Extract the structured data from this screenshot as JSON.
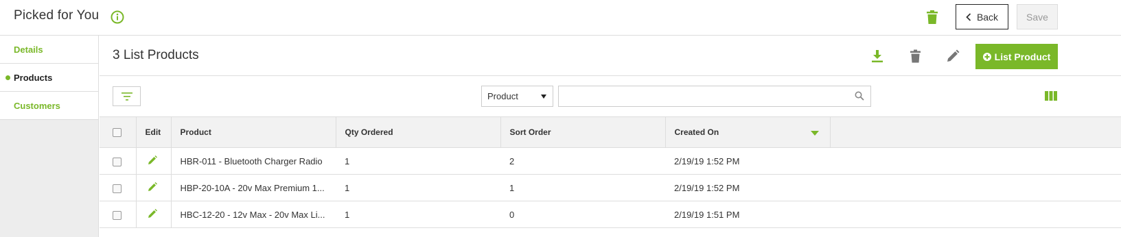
{
  "header": {
    "title": "Picked for You",
    "info_icon": "info-circle-icon",
    "delete_icon": "trash-icon",
    "back_label": "Back",
    "save_label": "Save"
  },
  "sidebar": {
    "items": [
      {
        "label": "Details",
        "active": false
      },
      {
        "label": "Products",
        "active": true
      },
      {
        "label": "Customers",
        "active": false
      }
    ]
  },
  "main": {
    "title": "3 List Products",
    "toolbar_icons": [
      "download-icon",
      "trash-icon",
      "pencil-icon"
    ],
    "add_button_label": "List Product",
    "search": {
      "field_selected": "Product",
      "placeholder": "",
      "value": ""
    }
  },
  "table": {
    "columns": [
      "Edit",
      "Product",
      "Qty Ordered",
      "Sort Order",
      "Created On"
    ],
    "sorted_column": "Created On",
    "sort_direction": "descending",
    "rows": [
      {
        "product": "HBR-011 - Bluetooth Charger Radio",
        "qty": "1",
        "sort": "2",
        "created": "2/19/19 1:52 PM"
      },
      {
        "product": "HBP-20-10A - 20v Max Premium 1...",
        "qty": "1",
        "sort": "1",
        "created": "2/19/19 1:52 PM"
      },
      {
        "product": "HBC-12-20 - 12v Max - 20v Max Li...",
        "qty": "1",
        "sort": "0",
        "created": "2/19/19 1:51 PM"
      }
    ]
  },
  "colors": {
    "accent": "#7ab829",
    "icon_gray": "#777777"
  }
}
